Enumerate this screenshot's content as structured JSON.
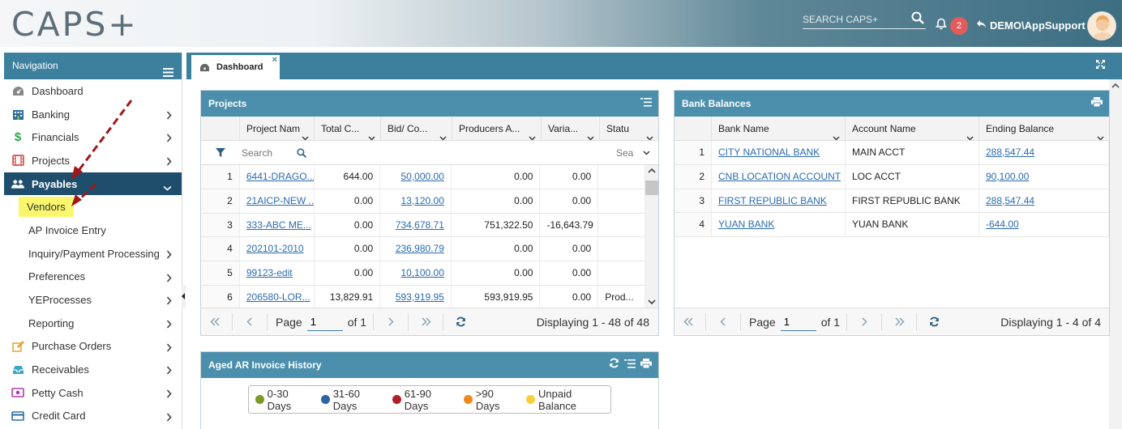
{
  "header": {
    "logo": "CAPS+",
    "search_placeholder": "SEARCH CAPS+",
    "notification_count": "2",
    "user": "DEMO\\AppSupport"
  },
  "sidebar": {
    "title": "Navigation",
    "items": [
      {
        "label": "Dashboard",
        "icon": "dashboard-icon"
      },
      {
        "label": "Banking",
        "icon": "bank-icon"
      },
      {
        "label": "Financials",
        "icon": "dollar-icon"
      },
      {
        "label": "Projects",
        "icon": "film-icon"
      },
      {
        "label": "Payables",
        "icon": "users-icon"
      }
    ],
    "payables_sub": [
      {
        "label": "Vendors"
      },
      {
        "label": "AP Invoice Entry"
      },
      {
        "label": "Inquiry/Payment Processing"
      },
      {
        "label": "Preferences"
      },
      {
        "label": "YEProcesses"
      },
      {
        "label": "Reporting"
      }
    ],
    "more_items": [
      {
        "label": "Purchase Orders",
        "icon": "edit-icon"
      },
      {
        "label": "Receivables",
        "icon": "inbox-icon"
      },
      {
        "label": "Petty Cash",
        "icon": "cash-icon"
      },
      {
        "label": "Credit Card",
        "icon": "credit-card-icon"
      }
    ]
  },
  "tabs": {
    "dashboard": "Dashboard",
    "close": "×"
  },
  "projects": {
    "title": "Projects",
    "columns": [
      "Project Nam",
      "Total C...",
      "Bid/ Co...",
      "Producers A...",
      "Varia...",
      "Statu"
    ],
    "search_placeholder": "Search",
    "status_search_placeholder": "Sea",
    "rows": [
      {
        "n": "1",
        "project": "6441-DRAGO...",
        "total": "644.00",
        "bid": "50,000.00",
        "producers": "0.00",
        "variance": "0.00",
        "status": ""
      },
      {
        "n": "2",
        "project": "21AICP-NEW ...",
        "total": "0.00",
        "bid": "13,120.00",
        "producers": "0.00",
        "variance": "0.00",
        "status": ""
      },
      {
        "n": "3",
        "project": "333-ABC ME...",
        "total": "0.00",
        "bid": "734,678.71",
        "producers": "751,322.50",
        "variance": "-16,643.79",
        "status": ""
      },
      {
        "n": "4",
        "project": "202101-2010",
        "total": "0.00",
        "bid": "236,980.79",
        "producers": "0.00",
        "variance": "0.00",
        "status": ""
      },
      {
        "n": "5",
        "project": "99123-edit",
        "total": "0.00",
        "bid": "10,100.00",
        "producers": "0.00",
        "variance": "0.00",
        "status": ""
      },
      {
        "n": "6",
        "project": "206580-LOR...",
        "total": "13,829.91",
        "bid": "593,919.95",
        "producers": "593,919.95",
        "variance": "0.00",
        "status": "Prod..."
      }
    ],
    "pager": {
      "page_label": "Page",
      "page": "1",
      "of": "of 1",
      "display": "Displaying 1 - 48 of 48"
    }
  },
  "bank": {
    "title": "Bank Balances",
    "columns": [
      "Bank Name",
      "Account Name",
      "Ending Balance"
    ],
    "rows": [
      {
        "n": "1",
        "bank": "CITY NATIONAL BANK",
        "account": "MAIN ACCT",
        "balance": "288,547.44"
      },
      {
        "n": "2",
        "bank": "CNB LOCATION ACCOUNT",
        "account": "LOC ACCT",
        "balance": "90,100.00"
      },
      {
        "n": "3",
        "bank": "FIRST REPUBLIC BANK",
        "account": "FIRST REPUBLIC BANK",
        "balance": "288,547.44"
      },
      {
        "n": "4",
        "bank": "YUAN BANK",
        "account": "YUAN BANK",
        "balance": "-644.00"
      }
    ],
    "pager": {
      "page_label": "Page",
      "page": "1",
      "of": "of 1",
      "display": "Displaying 1 - 4 of 4"
    }
  },
  "aged": {
    "title": "Aged AR Invoice History",
    "legend": [
      {
        "label": "0-30 Days",
        "color": "#7a9a2a"
      },
      {
        "label": "31-60 Days",
        "color": "#2b64a8"
      },
      {
        "label": "61-90 Days",
        "color": "#b0202a"
      },
      {
        "label": ">90 Days",
        "color": "#f08a1c"
      },
      {
        "label": "Unpaid Balance",
        "color": "#f7cf3a"
      }
    ]
  }
}
